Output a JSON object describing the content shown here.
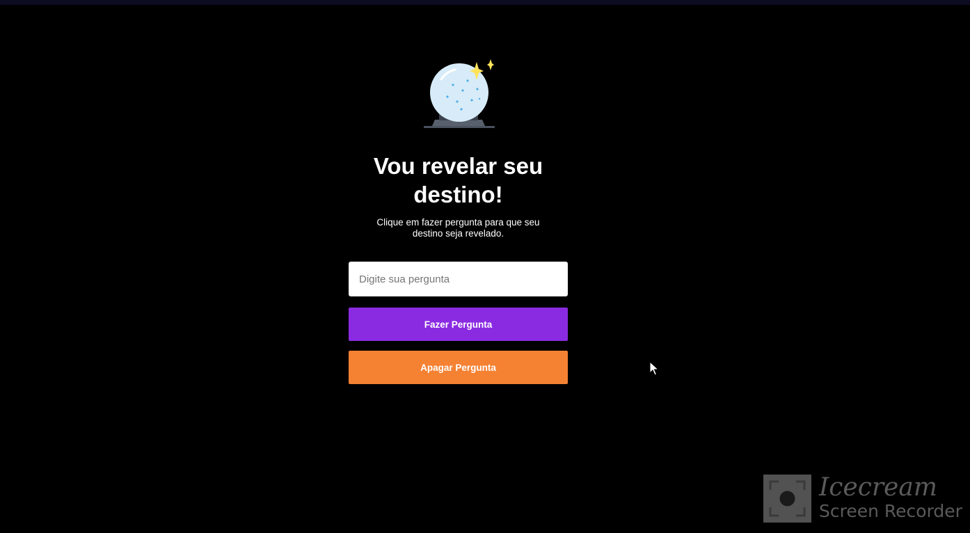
{
  "main": {
    "title": "Vou revelar seu destino!",
    "subtitle": "Clique em fazer pergunta para que seu destino seja revelado.",
    "icon": "crystal-ball-icon"
  },
  "form": {
    "input_value": "",
    "input_placeholder": "Digite sua pergunta",
    "ask_label": "Fazer Pergunta",
    "clear_label": "Apagar Pergunta"
  },
  "colors": {
    "background": "#000000",
    "ask_button": "#8a2be2",
    "clear_button": "#f58133",
    "sparkle": "#fde35a"
  },
  "watermark": {
    "brand": "Icecream",
    "product": "Screen Recorder"
  }
}
